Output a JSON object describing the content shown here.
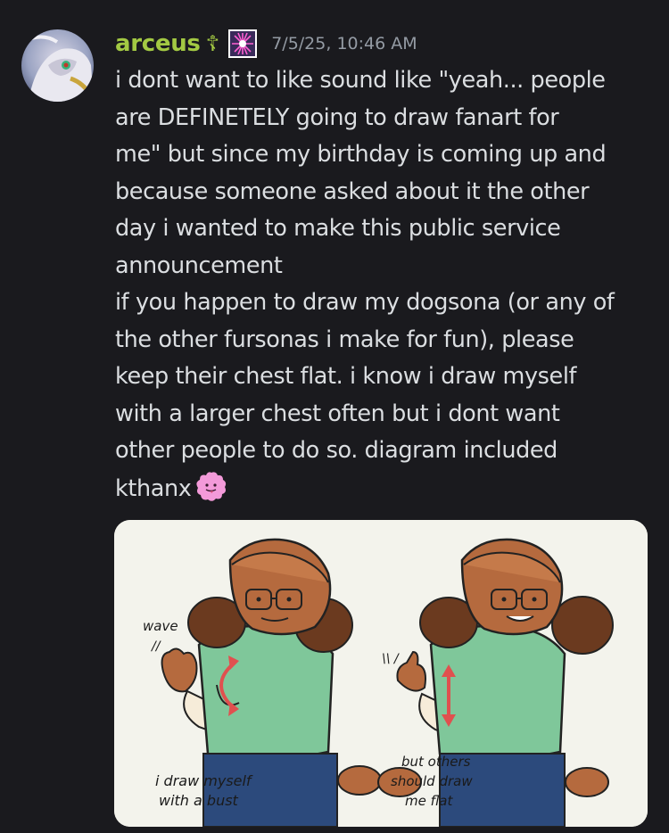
{
  "message": {
    "username": "arceus",
    "role_glyph": "☦",
    "role_icon": "sparkle-badge-icon",
    "timestamp": "7/5/25, 10:46 AM",
    "lines": [
      "i dont want to like sound like \"yeah... people",
      "are DEFINETELY going to draw fanart for",
      "me\" but since my birthday is coming up and",
      "because someone asked about it the other",
      "day i wanted to make this public service",
      "announcement",
      "if you happen to draw my dogsona (or any of",
      "the other fursonas i make for fun), please",
      "keep their chest flat. i know i draw myself",
      "with a larger chest often but i dont want",
      "other people to do so. diagram included",
      "kthanx"
    ],
    "emoji": "pink-blob-tongue-emoji"
  },
  "attachment": {
    "left_caption_1": "wave",
    "left_caption_2": "//",
    "left_caption_3": "i draw myself",
    "left_caption_4": "with a bust",
    "right_caption_1": "\\\\ /",
    "right_caption_2": "but others",
    "right_caption_3": "should draw",
    "right_caption_4": "me flat"
  },
  "colors": {
    "background": "#1a1a1e",
    "username": "#a3c943",
    "timestamp": "#949ba4",
    "text": "#dbdee1",
    "shirt": "#7fc79a",
    "fur": "#b56a3e",
    "arrow": "#e0504f"
  }
}
